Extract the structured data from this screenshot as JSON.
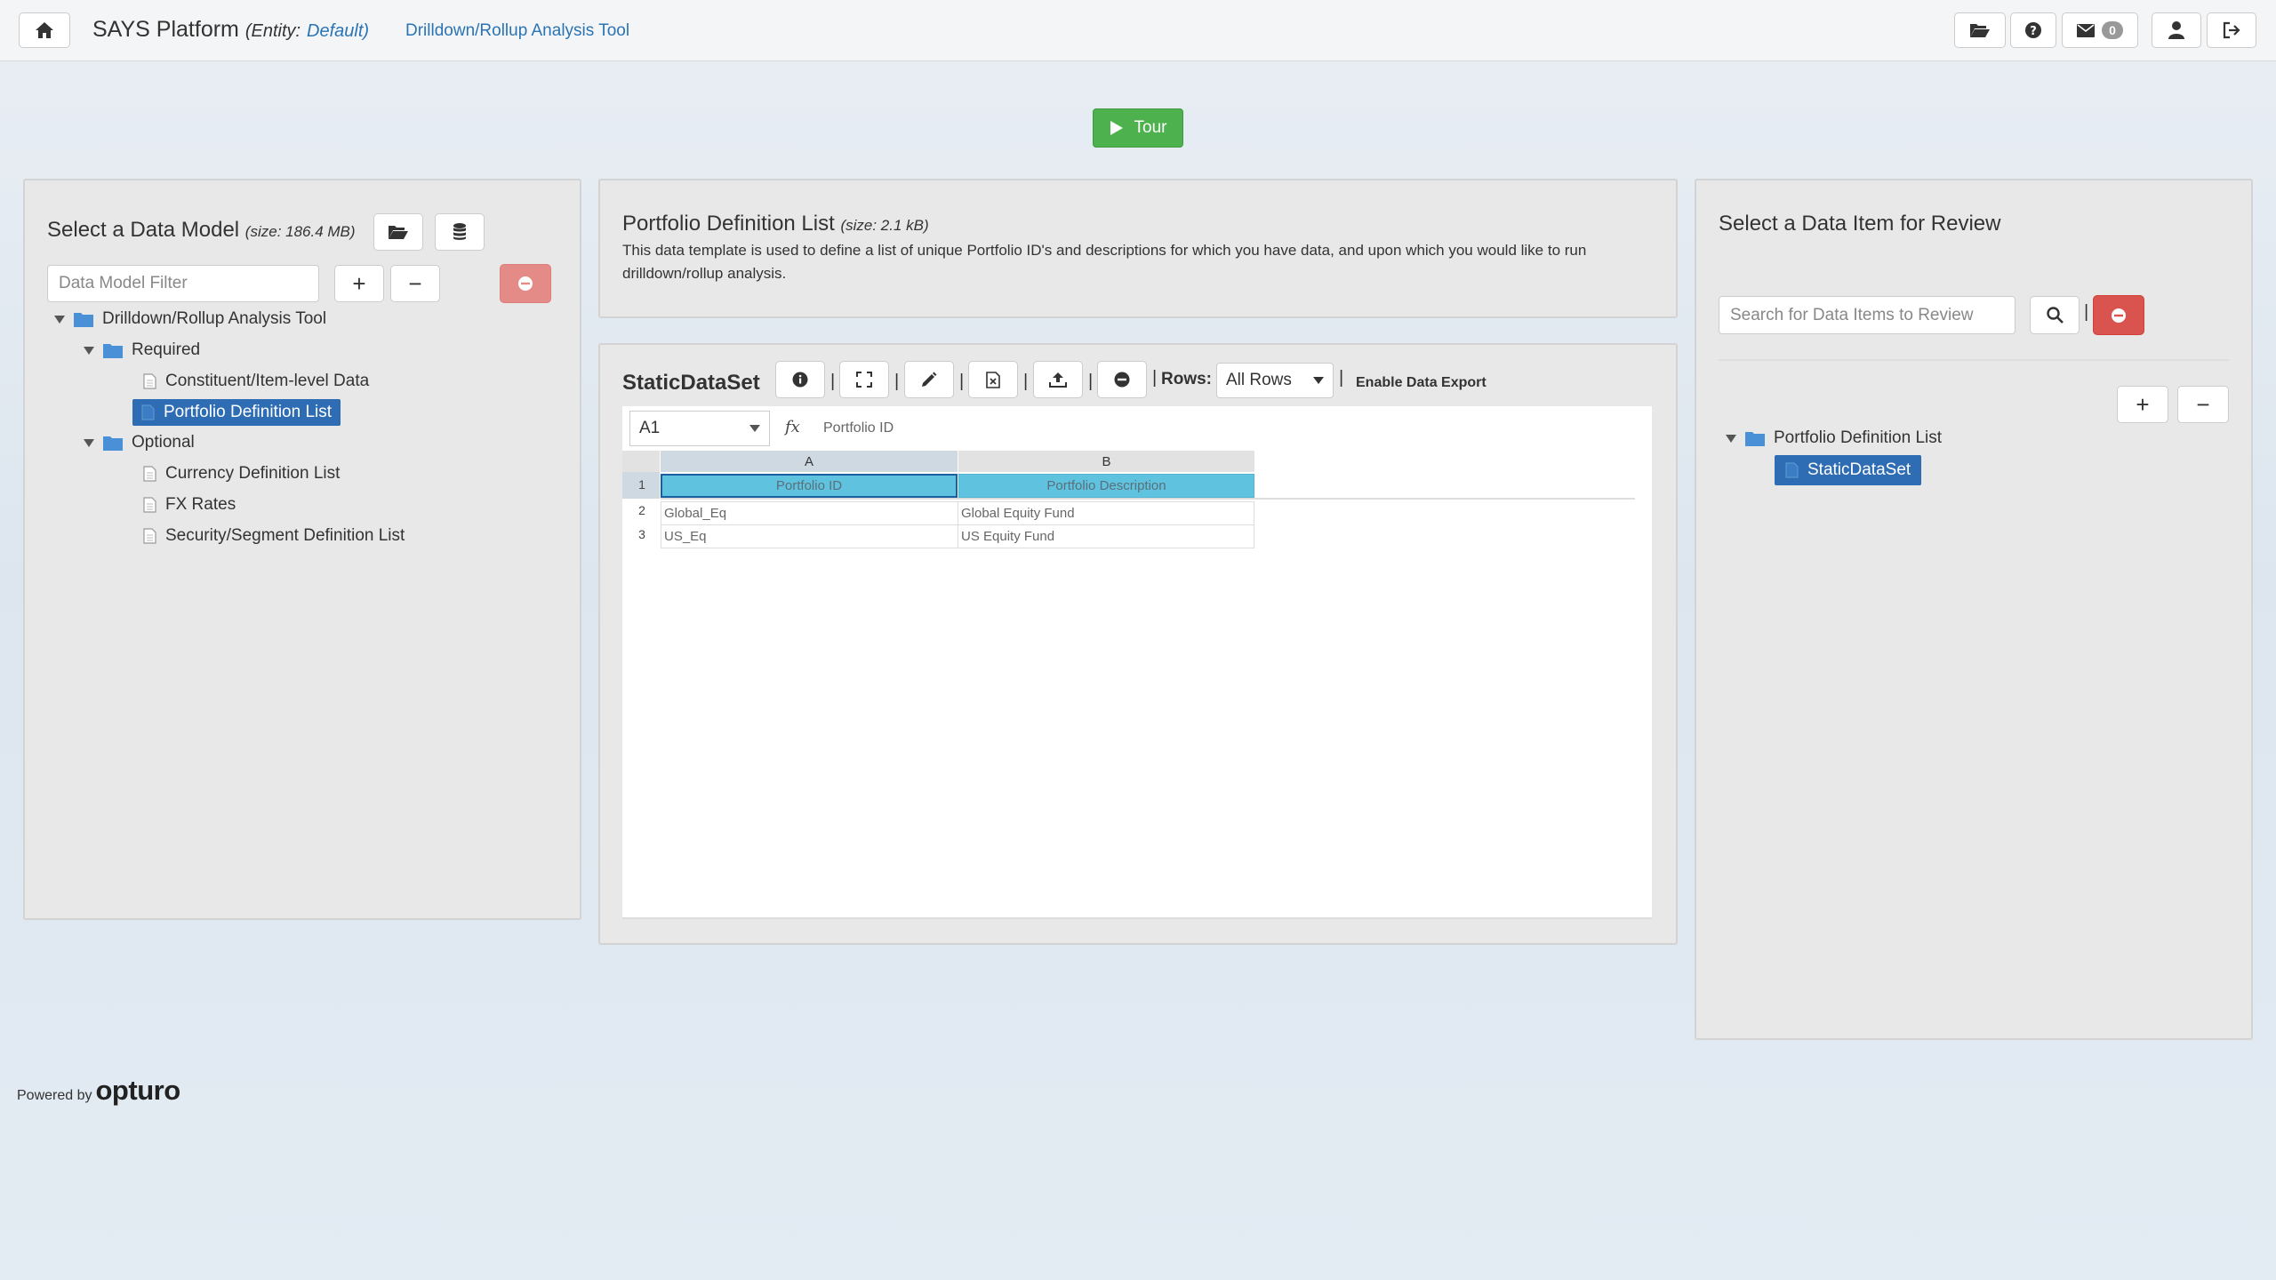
{
  "header": {
    "app_name": "SAYS Platform",
    "entity_label": "(Entity:",
    "entity_value": "Default)",
    "tool_link": "Drilldown/Rollup Analysis Tool",
    "mail_count": "0"
  },
  "tour": {
    "label": "Tour"
  },
  "left_panel": {
    "title": "Select a Data Model",
    "size": "(size: 186.4 MB)",
    "filter_placeholder": "Data Model Filter",
    "tree": {
      "root": "Drilldown/Rollup Analysis Tool",
      "required": "Required",
      "required_items": [
        "Constituent/Item-level Data",
        "Portfolio Definition List"
      ],
      "optional": "Optional",
      "optional_items": [
        "Currency Definition List",
        "FX Rates",
        "Security/Segment Definition List"
      ]
    }
  },
  "desc_panel": {
    "title": "Portfolio Definition List",
    "size": "(size: 2.1 kB)",
    "description": "This data template is used to define a list of unique Portfolio ID's and descriptions for which you have data, and upon which you would like to run drilldown/rollup analysis."
  },
  "dataset_panel": {
    "title": "StaticDataSet",
    "rows_label": "Rows:",
    "rows_value": "All Rows",
    "export_label": "Enable Data Export",
    "cell_ref": "A1",
    "formula_value": "Portfolio ID",
    "columns": [
      "A",
      "B"
    ],
    "rows": [
      {
        "num": "1",
        "cells": [
          "Portfolio ID",
          "Portfolio Description"
        ]
      },
      {
        "num": "2",
        "cells": [
          "Global_Eq",
          "Global Equity Fund"
        ]
      },
      {
        "num": "3",
        "cells": [
          "US_Eq",
          "US Equity Fund"
        ]
      }
    ]
  },
  "right_panel": {
    "title": "Select a Data Item for Review",
    "search_placeholder": "Search for Data Items to Review",
    "tree_root": "Portfolio Definition List",
    "tree_item": "StaticDataSet"
  },
  "footer": {
    "powered_by": "Powered by",
    "brand": "opturo"
  }
}
